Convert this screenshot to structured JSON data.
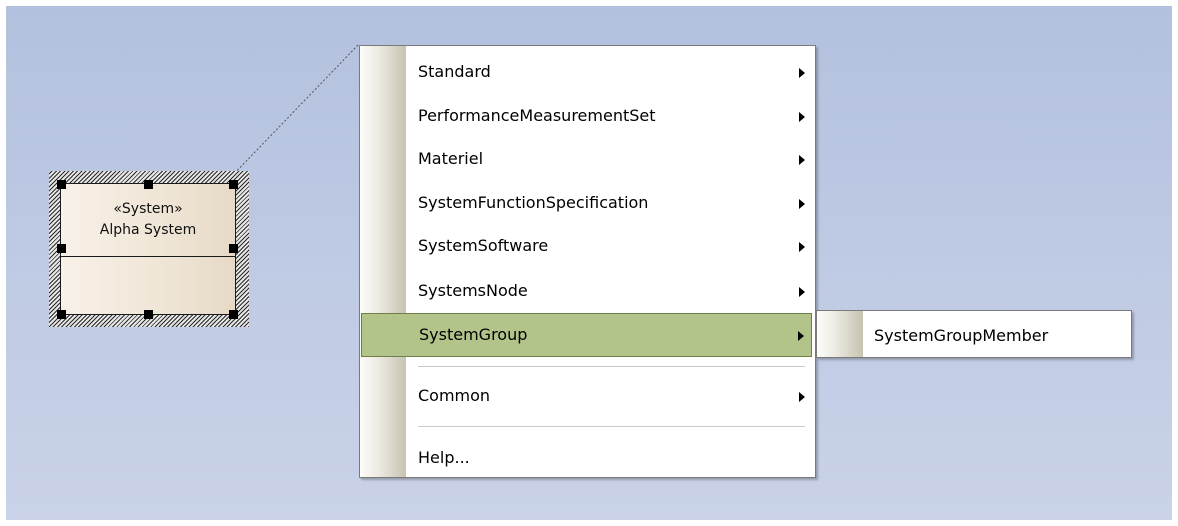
{
  "diagram_element": {
    "stereotype": "«System»",
    "name": "Alpha System"
  },
  "context_menu": {
    "items": [
      {
        "label": "Standard",
        "has_submenu": true
      },
      {
        "label": "PerformanceMeasurementSet",
        "has_submenu": true
      },
      {
        "label": "Materiel",
        "has_submenu": true
      },
      {
        "label": "SystemFunctionSpecification",
        "has_submenu": true
      },
      {
        "label": "SystemSoftware",
        "has_submenu": true
      },
      {
        "label": "SystemsNode",
        "has_submenu": true
      },
      {
        "label": "SystemGroup",
        "has_submenu": true,
        "highlighted": true
      },
      {
        "label": "Common",
        "has_submenu": true
      },
      {
        "label": "Help...",
        "has_submenu": false
      }
    ],
    "highlight_color": "#b2c48a"
  },
  "submenu": {
    "items": [
      {
        "label": "SystemGroupMember"
      }
    ]
  },
  "colors": {
    "canvas_top": "#b3c1de",
    "canvas_bottom": "#c9d2e8",
    "element_fill": "#efe5d6"
  }
}
